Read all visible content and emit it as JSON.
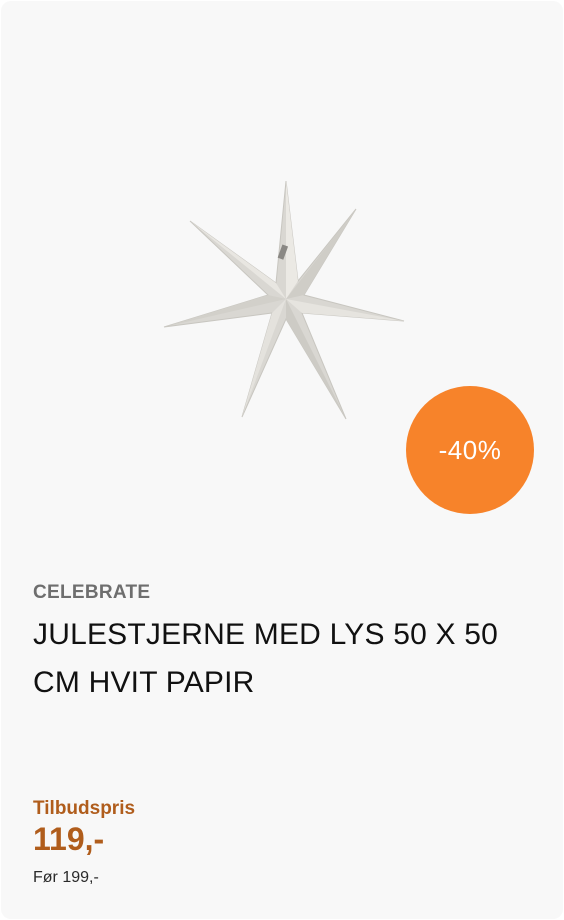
{
  "product": {
    "brand": "CELEBRATE",
    "title": "JULESTJERNE MED LYS 50 X 50 CM HVIT PAPIR",
    "discount_badge": "-40%",
    "price_label": "Tilbudspris",
    "price": "119,-",
    "old_price": "Før 199,-",
    "image_icon": "paper-star-lamp-image"
  },
  "colors": {
    "card_background": "#f8f8f8",
    "badge": "#f7832a",
    "price": "#b05d1c"
  }
}
